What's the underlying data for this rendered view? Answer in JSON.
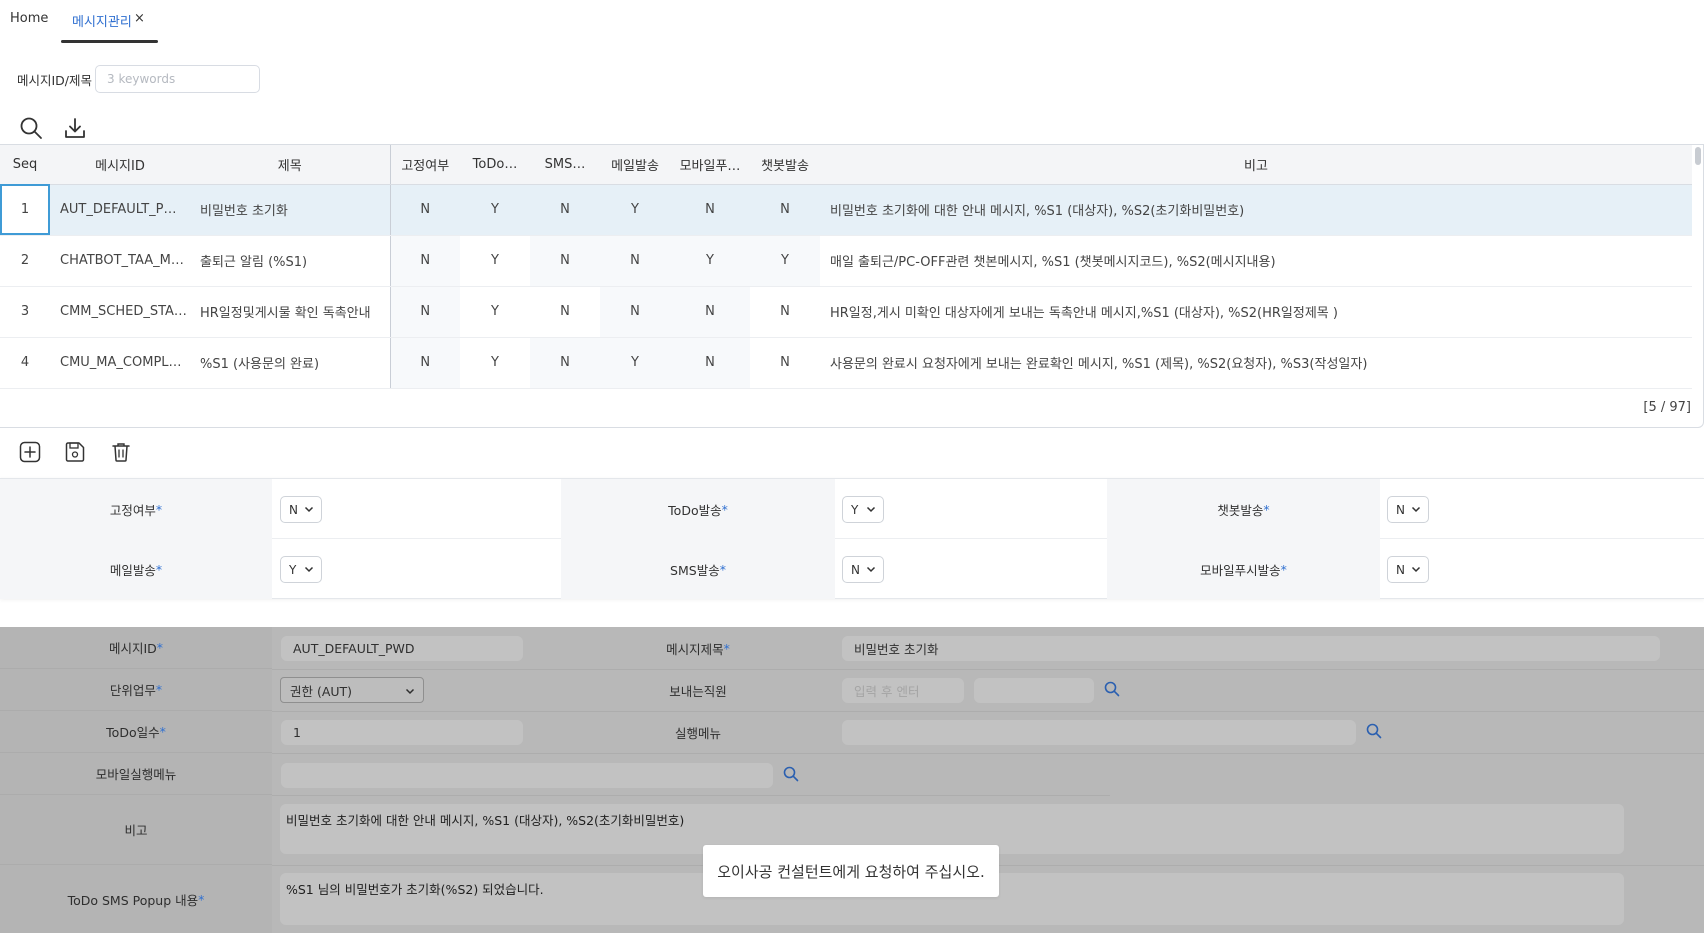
{
  "tabs": {
    "home": "Home",
    "active": "메시지관리",
    "close": "×"
  },
  "search": {
    "label": "메시지ID/제목",
    "placeholder": "3 keywords"
  },
  "grid": {
    "columns": [
      "Seq",
      "메시지ID",
      "제목",
      "고정여부",
      "ToDo…",
      "SMS…",
      "메일발송",
      "모바일푸…",
      "챗봇발송",
      "비고"
    ],
    "rows": [
      {
        "seq": "1",
        "id": "AUT_DEFAULT_P…",
        "title": "비밀번호 초기화",
        "fixed": "N",
        "todo": "Y",
        "sms": "N",
        "mail": "Y",
        "mobile": "N",
        "chatbot": "N",
        "note": "비밀번호 초기화에 대한 안내 메시지, %S1 (대상자), %S2(초기화비밀번호)"
      },
      {
        "seq": "2",
        "id": "CHATBOT_TAA_M…",
        "title": "출퇴근 알림 (%S1)",
        "fixed": "N",
        "todo": "Y",
        "sms": "N",
        "mail": "N",
        "mobile": "Y",
        "chatbot": "Y",
        "note": "매일 출퇴근/PC-OFF관련 챗본메시지, %S1 (챗봇메시지코드), %S2(메시지내용)"
      },
      {
        "seq": "3",
        "id": "CMM_SCHED_STA…",
        "title": "HR일정및게시물 확인 독촉안내",
        "fixed": "N",
        "todo": "Y",
        "sms": "N",
        "mail": "N",
        "mobile": "N",
        "chatbot": "N",
        "note": "HR일정,게시 미확인 대상자에게 보내는 독촉안내 메시지,%S1 (대상자), %S2(HR일정제목 )"
      },
      {
        "seq": "4",
        "id": "CMU_MA_COMPL…",
        "title": "%S1 (사용문의 완료)",
        "fixed": "N",
        "todo": "Y",
        "sms": "N",
        "mail": "Y",
        "mobile": "N",
        "chatbot": "N",
        "note": "사용문의 완료시 요청자에게 보내는 완료확인 메시지, %S1 (제목), %S2(요청자), %S3(작성일자)"
      }
    ],
    "count": "[5 / 97]"
  },
  "form_flags": {
    "fixed": {
      "label": "고정여부",
      "value": "N"
    },
    "todo": {
      "label": "ToDo발송",
      "value": "Y"
    },
    "chatbot": {
      "label": "챗봇발송",
      "value": "N"
    },
    "mail": {
      "label": "메일발송",
      "value": "Y"
    },
    "sms": {
      "label": "SMS발송",
      "value": "N"
    },
    "mobile_push": {
      "label": "모바일푸시발송",
      "value": "N"
    }
  },
  "form_detail": {
    "message_id": {
      "label": "메시지ID",
      "value": "AUT_DEFAULT_PWD"
    },
    "message_title": {
      "label": "메시지제목",
      "value": "비밀번호 초기화"
    },
    "unit_task": {
      "label": "단위업무",
      "value": "권한 (AUT)"
    },
    "sender": {
      "label": "보내는직원",
      "placeholder": "입력 후 엔터"
    },
    "todo_days": {
      "label": "ToDo일수",
      "value": "1"
    },
    "run_menu": {
      "label": "실행메뉴"
    },
    "mobile_run_menu": {
      "label": "모바일실행메뉴"
    },
    "note": {
      "label": "비고",
      "value": "비밀번호 초기화에 대한 안내 메시지, %S1 (대상자), %S2(초기화비밀번호)"
    },
    "todo_sms_popup": {
      "label": "ToDo SMS Popup 내용",
      "value": "%S1 님의 비밀번호가 초기화(%S2) 되었습니다."
    }
  },
  "toast": {
    "message": "오이사공 컨설턴트에게 요청하여 주십시오."
  },
  "colors": {
    "accent": "#2f6fd0",
    "selected_row": "#e6f0f7",
    "selected_cell_border": "#3f9bd6",
    "overlay": "#b8b8b8"
  }
}
